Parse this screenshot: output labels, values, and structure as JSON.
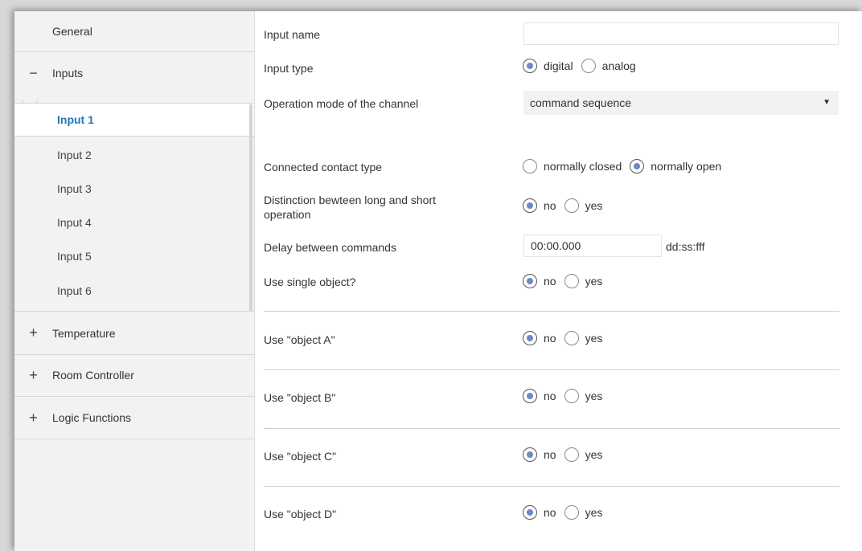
{
  "sidebar": {
    "general": "General",
    "inputs": {
      "toggle": "−",
      "label": "Inputs"
    },
    "input_items": [
      "Input 1",
      "Input 2",
      "Input 3",
      "Input 4",
      "Input 5",
      "Input 6"
    ],
    "temperature": {
      "toggle": "+",
      "label": "Temperature"
    },
    "room_controller": {
      "toggle": "+",
      "label": "Room Controller"
    },
    "logic_functions": {
      "toggle": "+",
      "label": "Logic Functions"
    }
  },
  "form": {
    "input_name": {
      "label": "Input name",
      "value": ""
    },
    "input_type": {
      "label": "Input type",
      "options": [
        "digital",
        "analog"
      ],
      "selected": "digital"
    },
    "operation_mode": {
      "label": "Operation mode of the channel",
      "value": "command sequence"
    },
    "contact_type": {
      "label": "Connected contact type",
      "options": [
        "normally closed",
        "normally open"
      ],
      "selected": "normally open"
    },
    "distinction": {
      "label_line1": "Distinction bewteen long and short",
      "label_line2": "operation",
      "options": [
        "no",
        "yes"
      ],
      "selected": "no"
    },
    "delay": {
      "label": "Delay between commands",
      "value": "00:00.000",
      "unit": "dd:ss:fff"
    },
    "single_object": {
      "label": "Use single object?",
      "options": [
        "no",
        "yes"
      ],
      "selected": "no"
    },
    "object_a": {
      "label": "Use \"object A\"",
      "options": [
        "no",
        "yes"
      ],
      "selected": "no"
    },
    "object_b": {
      "label": "Use \"object B\"",
      "options": [
        "no",
        "yes"
      ],
      "selected": "no"
    },
    "object_c": {
      "label": "Use \"object C\"",
      "options": [
        "no",
        "yes"
      ],
      "selected": "no"
    },
    "object_d": {
      "label": "Use \"object D\"",
      "options": [
        "no",
        "yes"
      ],
      "selected": "no"
    }
  },
  "colors": {
    "accent": "#1f78b4",
    "radio_fill": "#6a8cc0",
    "sidebar_bg": "#f2f2f2"
  }
}
